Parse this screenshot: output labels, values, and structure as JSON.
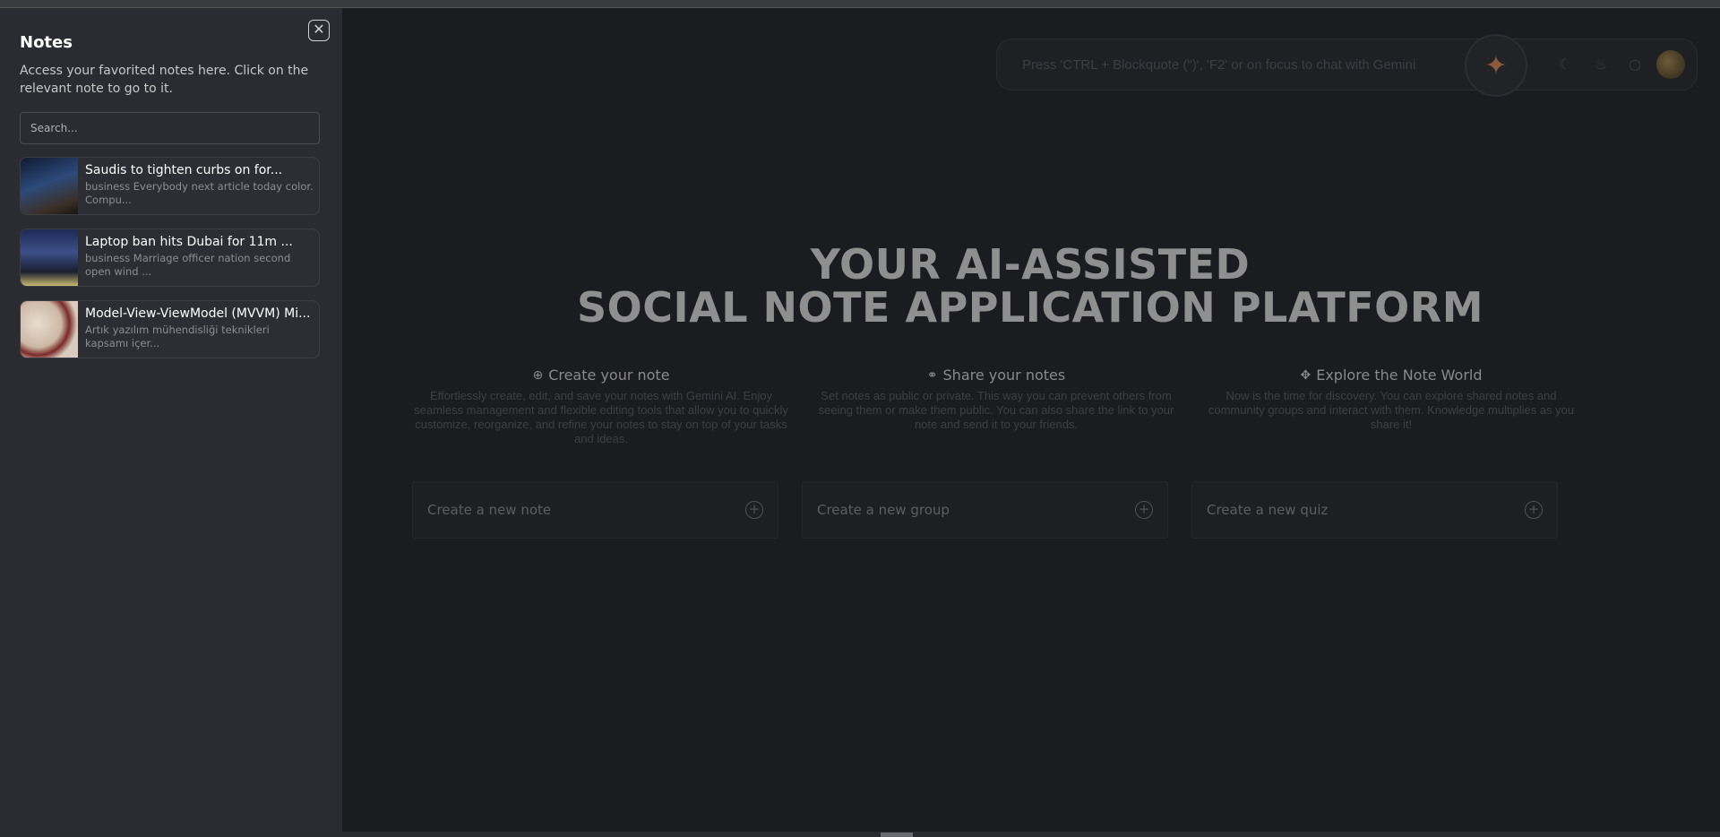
{
  "topbar": {
    "chat_placeholder": "Press 'CTRL + Blockquote (\")', 'F2' or on focus to chat with Gemini",
    "icons": [
      "magic-wand-icon",
      "moon-icon",
      "bell-icon",
      "chat-bubble-icon",
      "avatar"
    ]
  },
  "hero": {
    "line1": "YOUR AI-ASSISTED",
    "line2": "SOCIAL NOTE APPLICATION PLATFORM"
  },
  "features": [
    {
      "icon": "plus-circle-icon",
      "title": "Create your note",
      "desc": "Effortlessly create, edit, and save your notes with Gemini AI. Enjoy seamless management and flexible editing tools that allow you to quickly customize, reorganize, and refine your notes to stay on top of your tasks and ideas."
    },
    {
      "icon": "share-icon",
      "title": "Share your notes",
      "desc": "Set notes as public or private. This way you can prevent others from seeing them or make them public. You can also share the link to your note and send it to your friends."
    },
    {
      "icon": "telescope-icon",
      "title": "Explore the Note World",
      "desc": "Now is the time for discovery. You can explore shared notes and community groups and interact with them. Knowledge multiplies as you share it!"
    }
  ],
  "actions": [
    {
      "label": "Create a new note"
    },
    {
      "label": "Create a new group"
    },
    {
      "label": "Create a new quiz"
    }
  ],
  "drawer": {
    "title": "Notes",
    "subtitle": "Access your favorited notes here. Click on the relevant note to go to it.",
    "search_placeholder": "Search...",
    "notes": [
      {
        "title": "Saudis to tighten curbs on for...",
        "desc": "business Everybody next article today color. Compu..."
      },
      {
        "title": "Laptop ban hits Dubai for 11m ...",
        "desc": "business Marriage officer nation second open wind ..."
      },
      {
        "title": "Model-View-ViewModel (MVVM) Mi...",
        "desc": "Artık yazılım mühendisliği teknikleri kapsamı içer..."
      }
    ]
  }
}
